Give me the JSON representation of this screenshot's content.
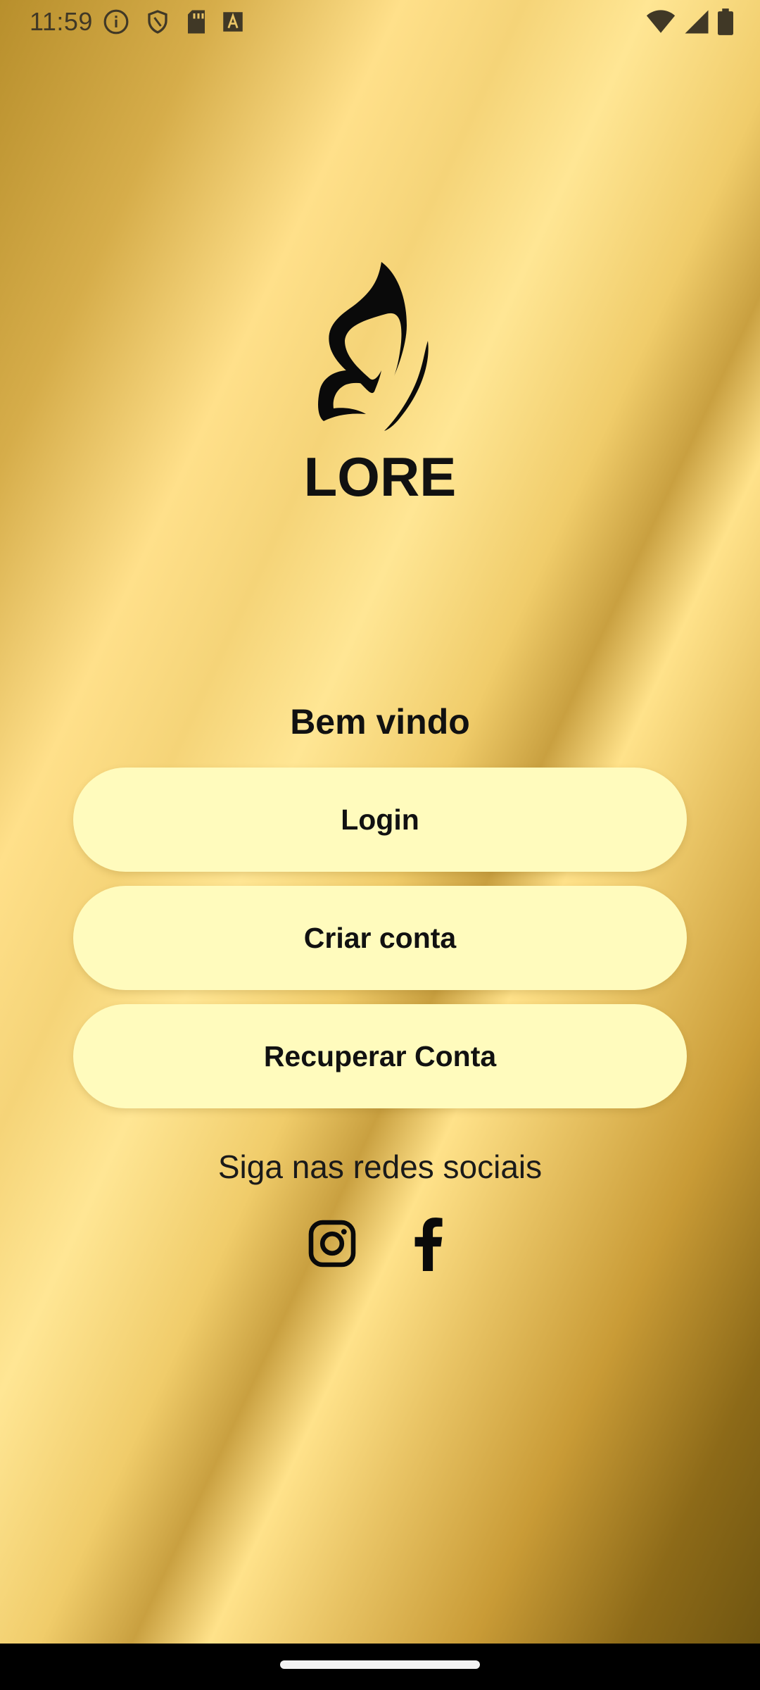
{
  "status_bar": {
    "time": "11:59",
    "left_icons": [
      "info-icon",
      "shield-icon",
      "sd-card-icon",
      "a-box-icon"
    ],
    "right_icons": [
      "wifi-icon",
      "signal-icon",
      "battery-icon"
    ]
  },
  "brand": {
    "name": "LORE",
    "logo_icon": "butterfly-logo-icon"
  },
  "welcome": {
    "title": "Bem vindo"
  },
  "buttons": {
    "login": "Login",
    "create_account": "Criar conta",
    "recover_account": "Recuperar Conta"
  },
  "social": {
    "label": "Siga nas redes sociais",
    "icons": [
      "instagram-icon",
      "facebook-icon"
    ]
  },
  "colors": {
    "button_bg": "#fffbbd",
    "text": "#111111",
    "gold_light": "#ffe08a",
    "gold_dark": "#6b520f"
  }
}
